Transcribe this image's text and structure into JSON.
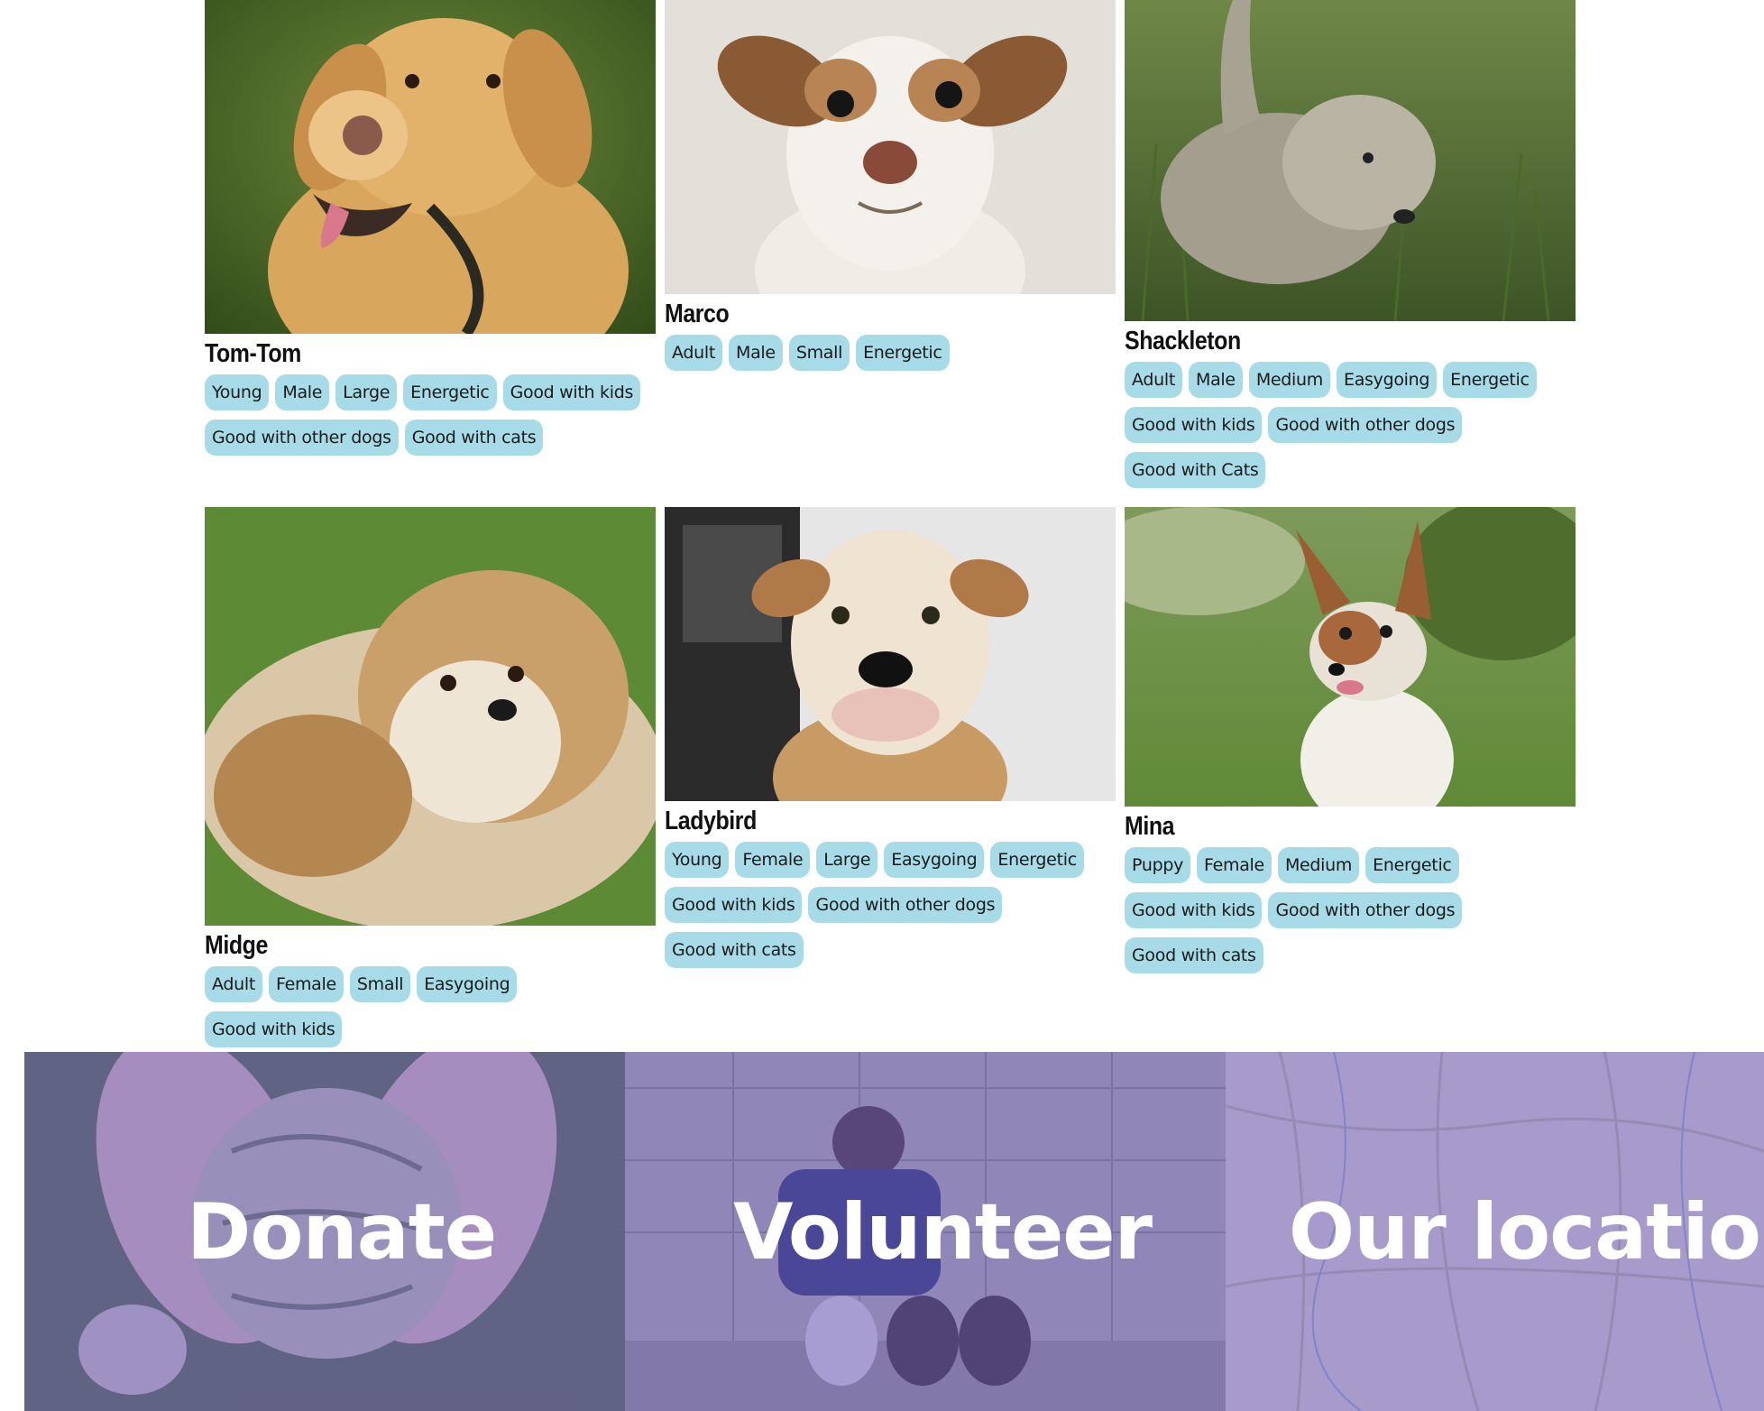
{
  "dogs": [
    {
      "name": "Tom-Tom",
      "tags": [
        "Young",
        "Male",
        "Large",
        "Energetic",
        "Good with kids",
        "Good with other dogs",
        "Good with cats"
      ]
    },
    {
      "name": "Marco",
      "tags": [
        "Adult",
        "Male",
        "Small",
        "Energetic"
      ]
    },
    {
      "name": "Shackleton",
      "tags": [
        "Adult",
        "Male",
        "Medium",
        "Easygoing",
        "Energetic",
        "Good with kids",
        "Good with other dogs",
        "Good with Cats"
      ]
    },
    {
      "name": "Midge",
      "tags": [
        "Adult",
        "Female",
        "Small",
        "Easygoing",
        "Good with kids"
      ]
    },
    {
      "name": "Ladybird",
      "tags": [
        "Young",
        "Female",
        "Large",
        "Easygoing",
        "Energetic",
        "Good with kids",
        "Good with other dogs",
        "Good with cats"
      ]
    },
    {
      "name": "Mina",
      "tags": [
        "Puppy",
        "Female",
        "Medium",
        "Energetic",
        "Good with kids",
        "Good with other dogs",
        "Good with cats"
      ]
    }
  ],
  "footer_tiles": [
    {
      "label": "Donate"
    },
    {
      "label": "Volunteer"
    },
    {
      "label": "Our location"
    }
  ],
  "colors": {
    "tag_background": "#a7dbe8",
    "tile_overlay": "#705cbe",
    "tile_text": "#ffffff"
  }
}
